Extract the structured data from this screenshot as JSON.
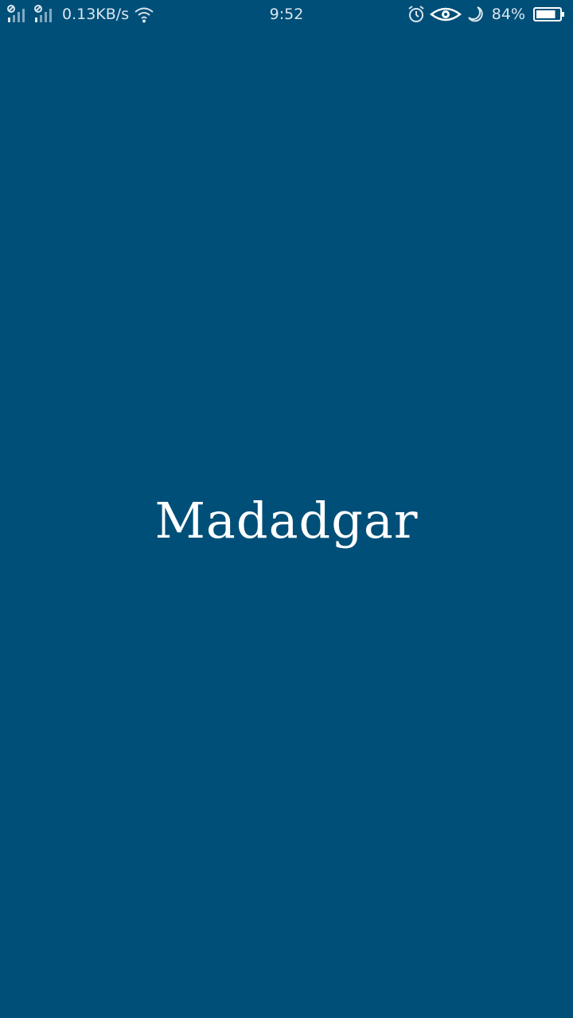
{
  "status_bar": {
    "net_speed": "0.13KB/s",
    "time": "9:52",
    "battery_percent": "84%",
    "battery_level": 0.84,
    "icons": [
      "signal-sim1-icon",
      "signal-sim2-icon",
      "wifi-icon",
      "alarm-icon",
      "eye-comfort-icon",
      "do-not-disturb-moon-icon",
      "battery-icon"
    ]
  },
  "splash": {
    "app_name": "Madadgar"
  },
  "colors": {
    "background": "#004f78",
    "text": "#ffffff",
    "status_text": "#d9e6ee"
  }
}
